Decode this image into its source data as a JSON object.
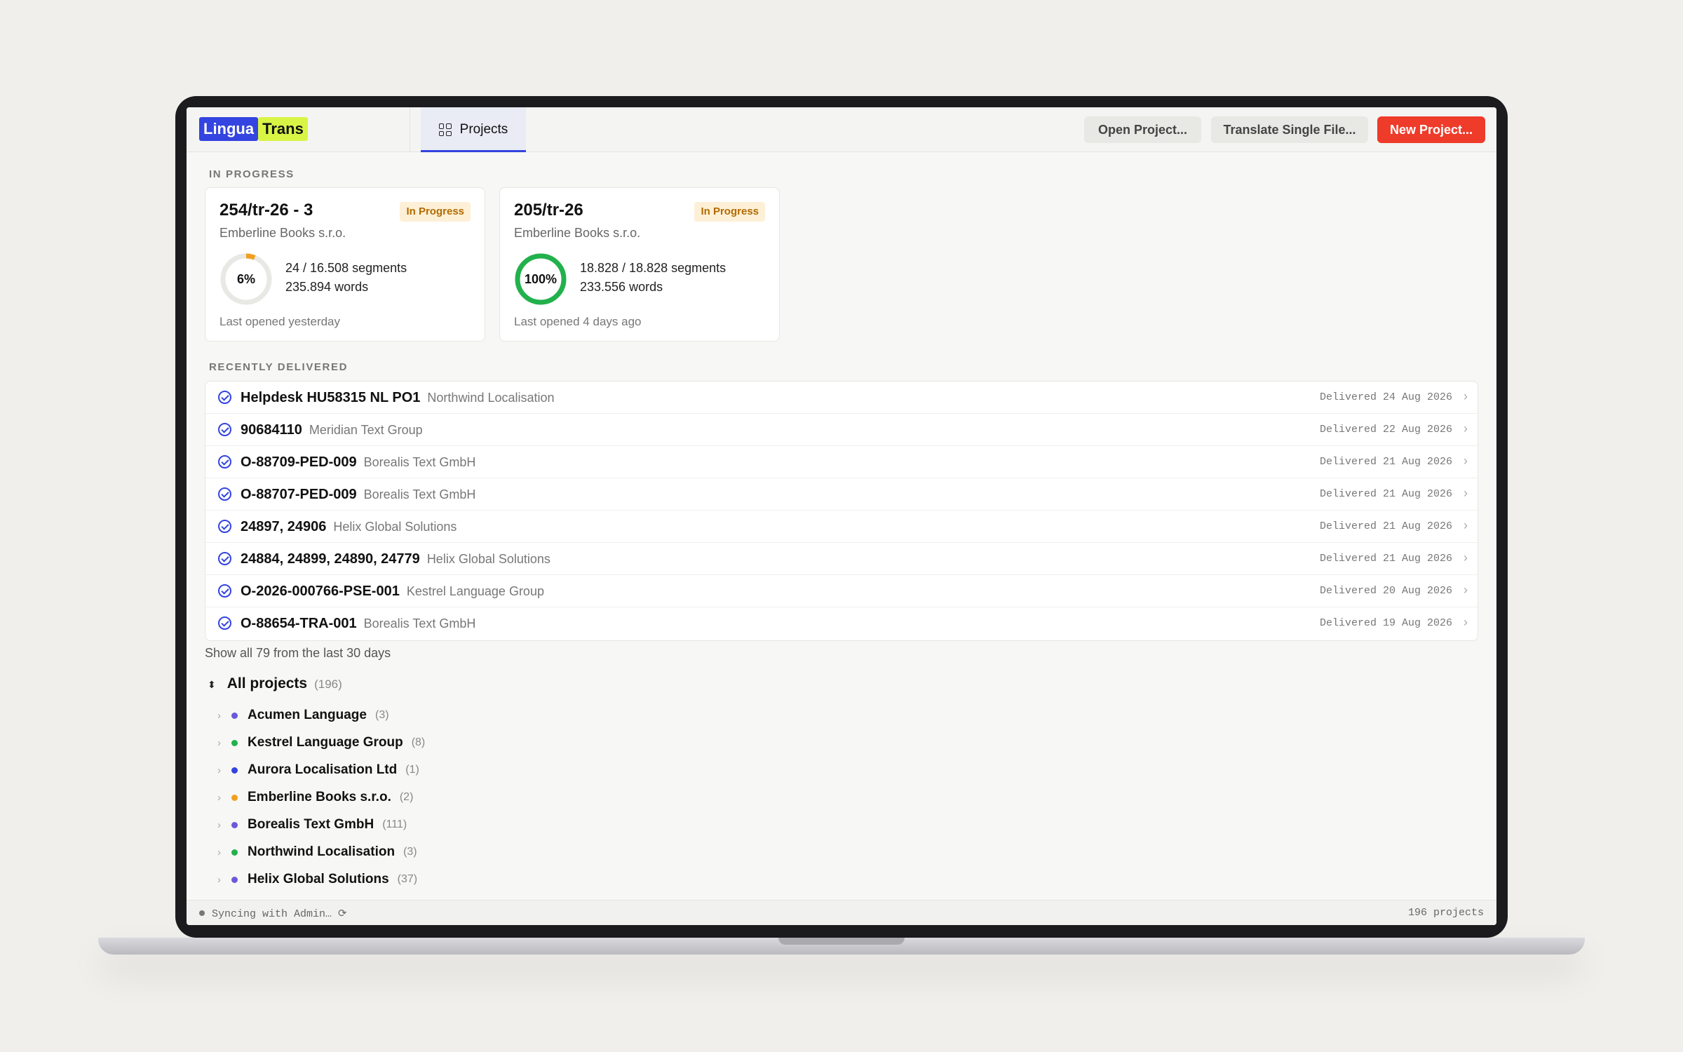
{
  "header": {
    "logo_part1": "Lingua",
    "logo_part2": "Trans",
    "tab_projects": "Projects",
    "open_project": "Open Project...",
    "translate_single": "Translate Single File...",
    "new_project": "New Project..."
  },
  "in_progress": {
    "label": "IN PROGRESS",
    "cards": [
      {
        "title": "254/tr-26 - 3",
        "status": "In Progress",
        "client": "Emberline Books s.r.o.",
        "percent_label": "6%",
        "progress": 0.06,
        "ring_color": "#f0a020",
        "segments": "24 / 16.508 segments",
        "words": "235.894 words",
        "last_opened": "Last opened yesterday"
      },
      {
        "title": "205/tr-26",
        "status": "In Progress",
        "client": "Emberline Books s.r.o.",
        "percent_label": "100%",
        "progress": 1.0,
        "ring_color": "#22b14c",
        "segments": "18.828 / 18.828 segments",
        "words": "233.556 words",
        "last_opened": "Last opened 4 days ago"
      }
    ]
  },
  "recently_delivered": {
    "label": "RECENTLY DELIVERED",
    "rows": [
      {
        "name": "Helpdesk HU58315 NL PO1",
        "client": "Northwind Localisation",
        "date": "Delivered 24 Aug 2026"
      },
      {
        "name": "90684110",
        "client": "Meridian Text Group",
        "date": "Delivered 22 Aug 2026"
      },
      {
        "name": "O-88709-PED-009",
        "client": "Borealis Text GmbH",
        "date": "Delivered 21 Aug 2026"
      },
      {
        "name": "O-88707-PED-009",
        "client": "Borealis Text GmbH",
        "date": "Delivered 21 Aug 2026"
      },
      {
        "name": "24897, 24906",
        "client": "Helix Global Solutions",
        "date": "Delivered 21 Aug 2026"
      },
      {
        "name": "24884, 24899, 24890, 24779",
        "client": "Helix Global Solutions",
        "date": "Delivered 21 Aug 2026"
      },
      {
        "name": "O-2026-000766-PSE-001",
        "client": "Kestrel Language Group",
        "date": "Delivered 20 Aug 2026"
      },
      {
        "name": "O-88654-TRA-001",
        "client": "Borealis Text GmbH",
        "date": "Delivered 19 Aug 2026"
      }
    ],
    "show_all": "Show all 79 from the last 30 days"
  },
  "all_projects": {
    "title": "All projects",
    "count": "(196)",
    "clients": [
      {
        "name": "Acumen Language",
        "count": "(3)",
        "color": "#6a5ad8"
      },
      {
        "name": "Kestrel Language Group",
        "count": "(8)",
        "color": "#22b14c"
      },
      {
        "name": "Aurora Localisation Ltd",
        "count": "(1)",
        "color": "#3344e0"
      },
      {
        "name": "Emberline Books s.r.o.",
        "count": "(2)",
        "color": "#f0a020"
      },
      {
        "name": "Borealis Text GmbH",
        "count": "(111)",
        "color": "#6a5ad8"
      },
      {
        "name": "Northwind Localisation",
        "count": "(3)",
        "color": "#22b14c"
      },
      {
        "name": "Helix Global Solutions",
        "count": "(37)",
        "color": "#6a5ad8"
      }
    ]
  },
  "status_bar": {
    "sync": "Syncing with Admin… ⟳",
    "total": "196 projects"
  }
}
